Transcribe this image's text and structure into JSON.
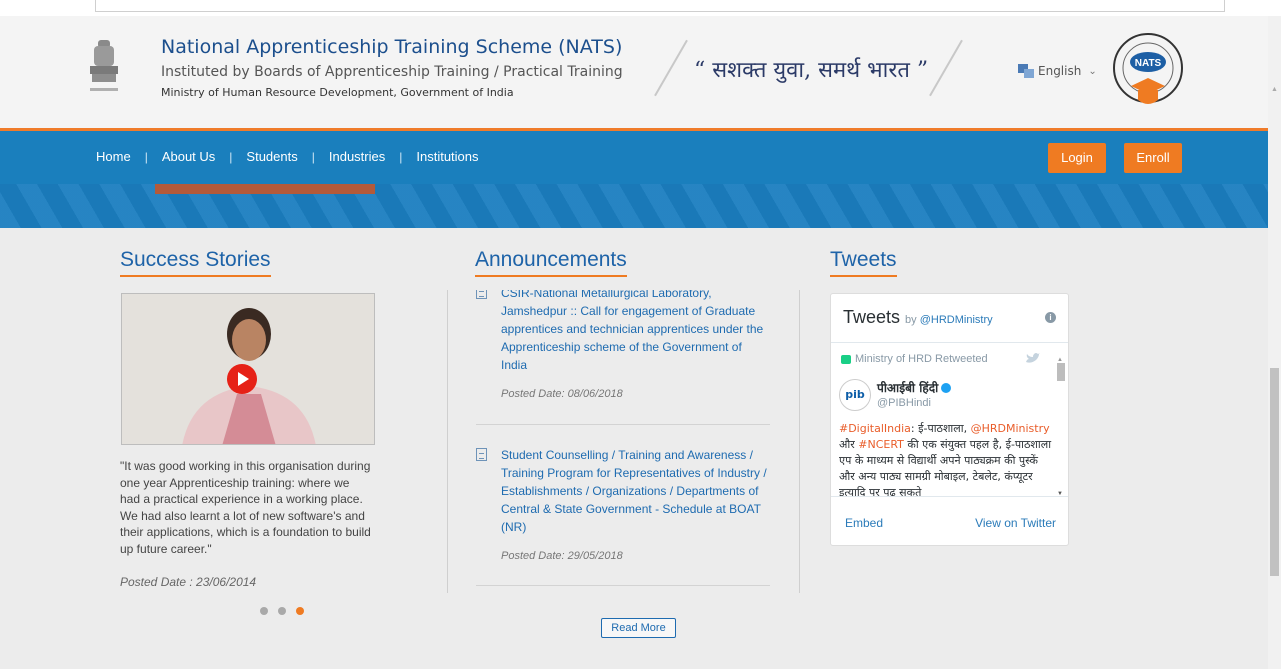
{
  "header": {
    "title": "National Apprenticeship Training Scheme (NATS)",
    "subtitle": "Instituted by Boards of Apprenticeship Training / Practical Training",
    "ministry": "Ministry of Human Resource Development, Government of India",
    "slogan": "“ सशक्त युवा, समर्थ भारत ”",
    "language": "English",
    "logo_text": "NATS"
  },
  "nav": {
    "items": [
      "Home",
      "About Us",
      "Students",
      "Industries",
      "Institutions"
    ],
    "separator": "|",
    "login": "Login",
    "enroll": "Enroll"
  },
  "success": {
    "title": "Success Stories",
    "quote": "\"It was good working in this organisation during one year Apprenticeship training: where we had a practical experience in a working place. We had also learnt a lot of new software's and their applications, which is a foundation to build up future career.\"",
    "date": "Posted Date : 23/06/2014",
    "slide_count": 3,
    "active_slide": 3
  },
  "announcements": {
    "title": "Announcements",
    "items": [
      {
        "text": "CSIR-National Metallurgical Laboratory, Jamshedpur :: Call for engagement of Graduate apprentices and technician apprentices under the Apprenticeship scheme of the Government of India",
        "date": "Posted Date: 08/06/2018"
      },
      {
        "text": "Student Counselling / Training and Awareness / Training Program for Representatives of Industry / Establishments / Organizations / Departments of Central & State Government - Schedule at BOAT (NR)",
        "date": "Posted Date: 29/05/2018"
      }
    ],
    "read_more": "Read More"
  },
  "tweets": {
    "title": "Tweets",
    "widget_title": "Tweets",
    "by": "by",
    "account": "@HRDMinistry",
    "retweeted": "Ministry of HRD Retweeted",
    "author_name": "पीआईबी हिंदी",
    "author_handle": "@PIBHindi",
    "avatar_text": "pib",
    "text_parts": [
      "#DigitalIndia",
      ": ई-पाठशाला, ",
      "@HRDMinistry",
      " और ",
      "#NCERT",
      " की एक संयुक्त पहल है, ई-पाठशाला एप के माध्यम से विद्यार्थी अपने पाठ्यक्रम की पुस्कें और अन्य पाठ्य सामग्री मोबाइल, टेबलेट, कंप्यूटर इत्यादि पर पढ़ सकते"
    ],
    "embed": "Embed",
    "view_on_twitter": "View on Twitter"
  },
  "colors": {
    "brand_blue": "#1a7fbd",
    "accent_orange": "#ef7b22",
    "link_blue": "#1e6bb0"
  }
}
